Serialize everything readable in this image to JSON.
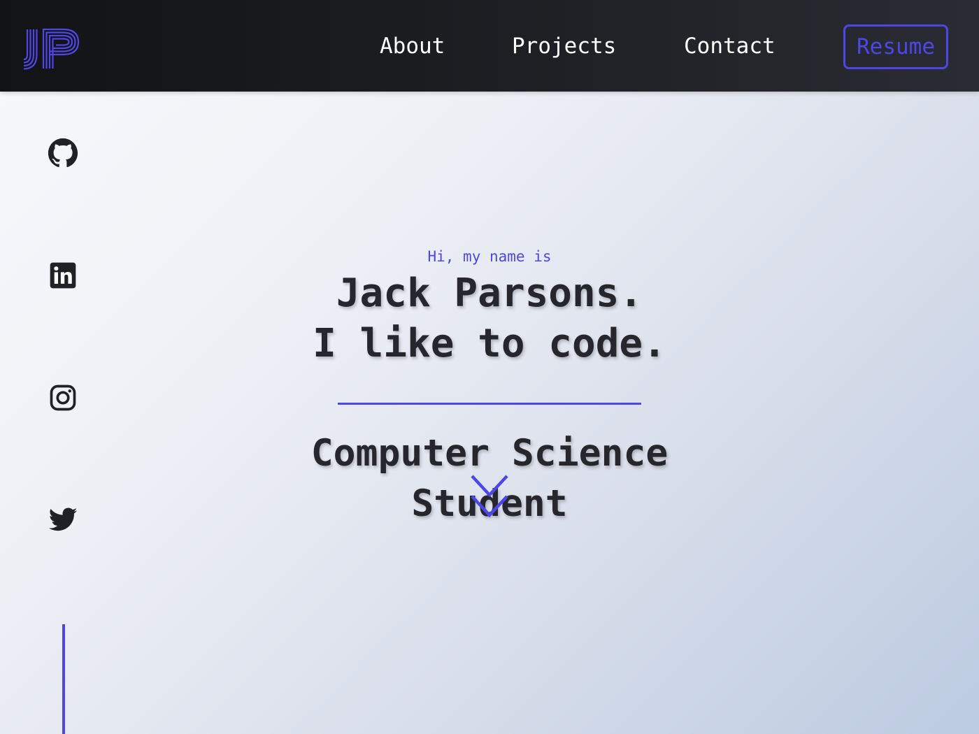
{
  "header": {
    "logo": {
      "text": "JP",
      "icon": "jp-monogram-logo"
    },
    "nav": [
      {
        "label": "About"
      },
      {
        "label": "Projects"
      },
      {
        "label": "Contact"
      }
    ],
    "resume_label": "Resume"
  },
  "social": [
    {
      "icon": "github-icon"
    },
    {
      "icon": "linkedin-icon"
    },
    {
      "icon": "instagram-icon"
    },
    {
      "icon": "twitter-icon"
    }
  ],
  "hero": {
    "greeting": "Hi, my name is",
    "name_line": "Jack Parsons.",
    "tagline_line": "I like to code.",
    "subtitle_line1": "Computer Science",
    "subtitle_line2": "Student"
  },
  "colors": {
    "accent": "#4f46e5",
    "header_bg": "#16171b",
    "text_dark": "#25272c"
  }
}
